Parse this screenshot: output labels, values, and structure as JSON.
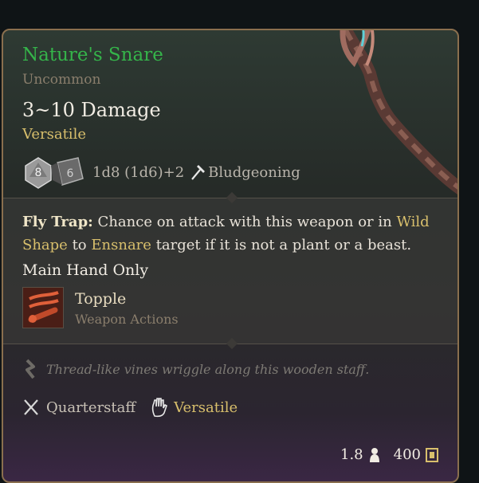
{
  "item": {
    "name": "Nature's Snare",
    "rarity": "Uncommon",
    "damage": "3~10 Damage",
    "damage_property": "Versatile",
    "dice": {
      "die1": "8",
      "die2": "6",
      "formula": "1d8 (1d6)+2",
      "damage_type": "Bludgeoning"
    }
  },
  "passive": {
    "title": "Fly Trap:",
    "text_1": "Chance on attack with this weapon or in",
    "link_1": "Wild Shape",
    "text_2": "to",
    "link_2": "Ensnare",
    "text_3": "target if it is not a plant or a beast."
  },
  "requirement": "Main Hand Only",
  "action": {
    "name": "Topple",
    "category": "Weapon Actions"
  },
  "flavor": "Thread-like vines wriggle along this wooden staff.",
  "tags": [
    {
      "label": "Quarterstaff"
    },
    {
      "label": "Versatile"
    }
  ],
  "footer": {
    "weight": "1.8",
    "value": "400"
  },
  "colors": {
    "name": "#35b44a",
    "highlight": "#d8bf6c",
    "border": "#8a6f4e"
  }
}
